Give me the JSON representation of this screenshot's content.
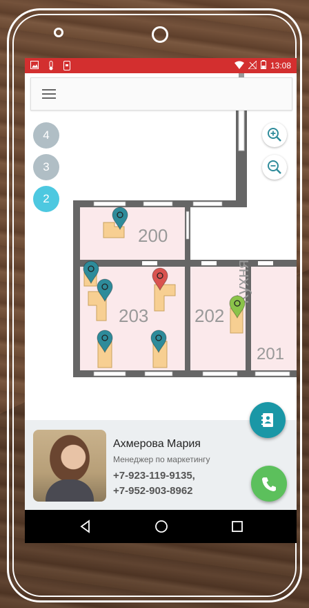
{
  "status_bar": {
    "time": "13:08",
    "left_icons": [
      "image-icon",
      "thermometer-icon",
      "phone-notification-icon"
    ],
    "right_icons": [
      "wifi-icon",
      "no-signal-icon",
      "battery-icon"
    ]
  },
  "toolbar": {
    "menu_icon": "hamburger-menu-icon"
  },
  "floors": [
    {
      "label": "4",
      "active": false
    },
    {
      "label": "3",
      "active": false
    },
    {
      "label": "2",
      "active": true
    }
  ],
  "zoom": {
    "in_icon": "zoom-in-icon",
    "out_icon": "zoom-out-icon"
  },
  "rooms": {
    "r200": "200",
    "r203": "203",
    "r202": "202",
    "kitchen": "Кухня",
    "r201": "201"
  },
  "colors": {
    "status_bar": "#d32f2f",
    "floor_inactive": "#b0bec5",
    "floor_active": "#4dc8e0",
    "room_fill": "#fbe9eb",
    "desk_fill": "#f7cf92",
    "wall": "#666666",
    "pin_teal": "#2e8b9a",
    "pin_red": "#d9534f",
    "pin_green": "#8bc34a",
    "fab_contact": "#1a97a6",
    "fab_call": "#5cc05c"
  },
  "contact": {
    "name": "Ахмерова Мария",
    "role": "Менеджер по маркетингу",
    "phone1": "+7-923-119-9135,",
    "phone2": "+7-952-903-8962"
  },
  "fabs": {
    "contact_icon": "contact-card-icon",
    "call_icon": "phone-icon"
  },
  "navbar": {
    "back_icon": "back-icon",
    "home_icon": "home-icon",
    "recents_icon": "recents-icon"
  }
}
